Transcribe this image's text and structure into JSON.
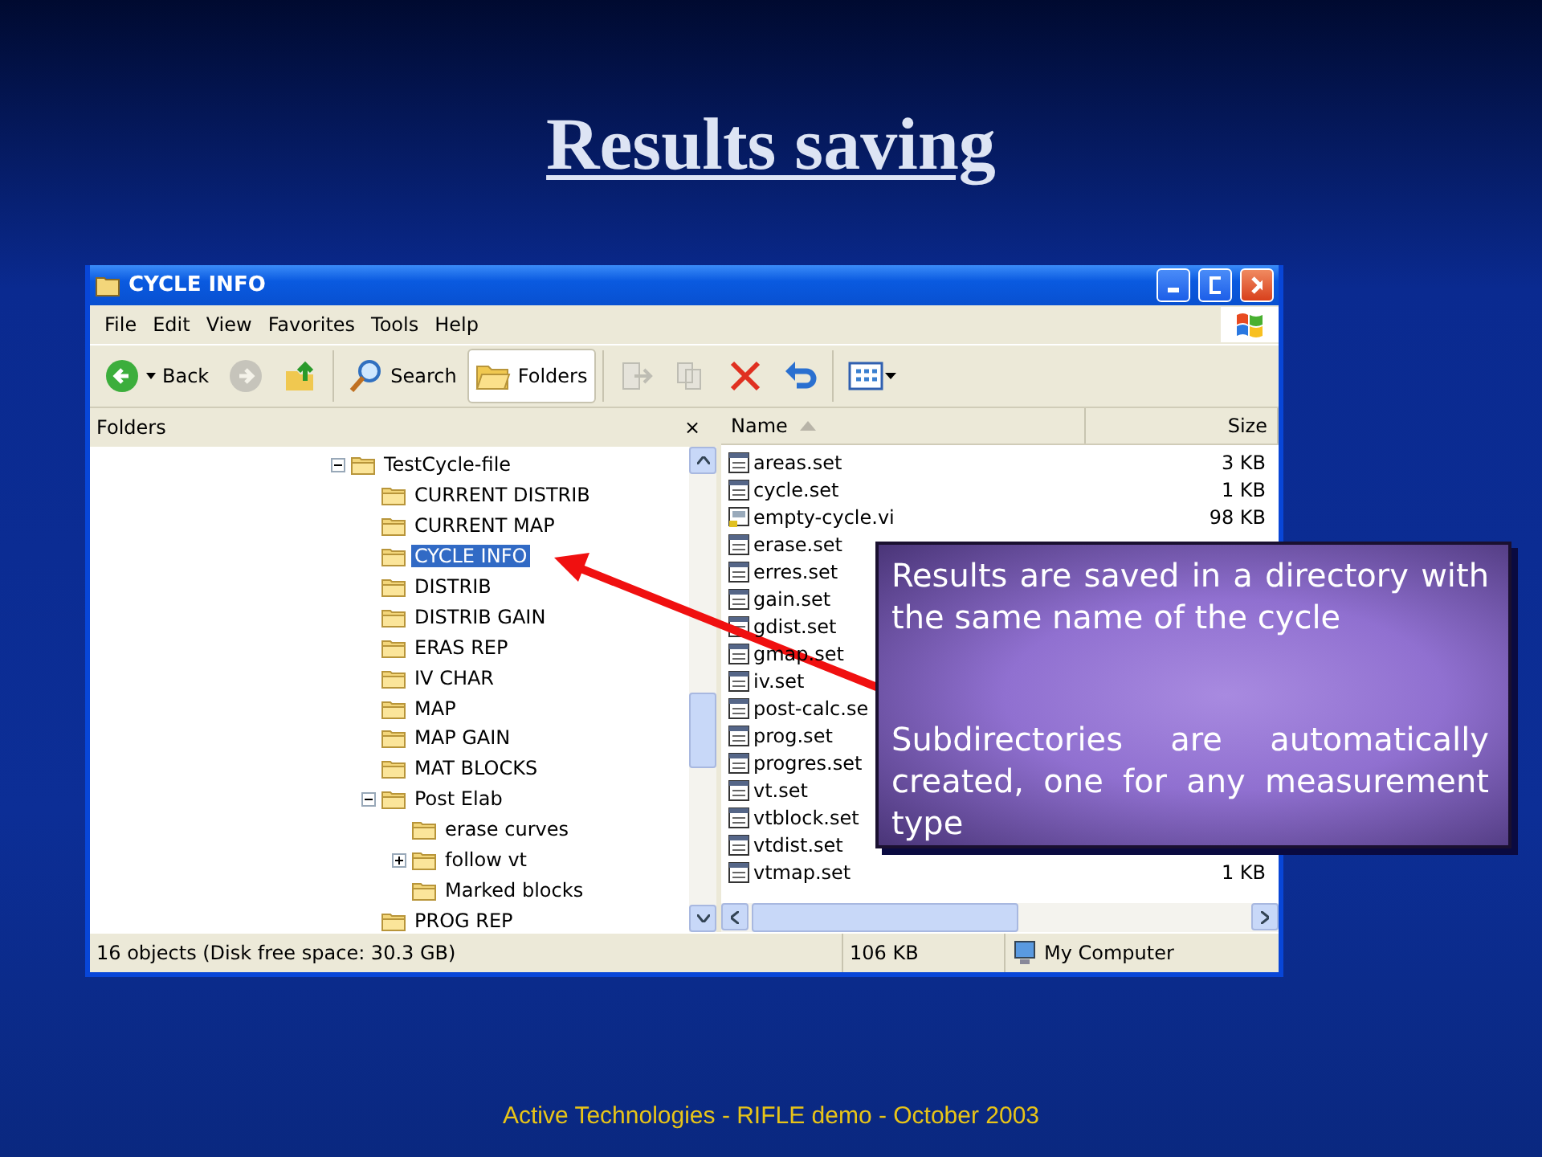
{
  "slide": {
    "title": "Results saving",
    "footer": "Active Technologies - RIFLE demo - October 2003"
  },
  "window": {
    "title": "CYCLE INFO",
    "menu": [
      "File",
      "Edit",
      "View",
      "Favorites",
      "Tools",
      "Help"
    ],
    "toolbar": [
      {
        "kind": "back",
        "label": "Back",
        "selected": false,
        "disabled": false
      },
      {
        "kind": "forward",
        "selected": false,
        "disabled": true
      },
      {
        "kind": "up",
        "selected": false,
        "disabled": false
      },
      {
        "kind": "search",
        "label": "Search",
        "selected": false,
        "disabled": false
      },
      {
        "kind": "folders",
        "label": "Folders",
        "selected": true,
        "disabled": false
      },
      {
        "kind": "move",
        "selected": false,
        "disabled": true
      },
      {
        "kind": "copy",
        "selected": false,
        "disabled": true
      },
      {
        "kind": "delete",
        "selected": false,
        "disabled": false
      },
      {
        "kind": "undo",
        "selected": false,
        "disabled": false
      },
      {
        "kind": "views",
        "selected": false,
        "disabled": false
      }
    ],
    "folders_pane": {
      "title": "Folders",
      "close": "×",
      "tree": [
        {
          "label": "TestCycle-file",
          "expanded": true,
          "selected": false,
          "children": [
            {
              "label": "CURRENT DISTRIB",
              "selected": false
            },
            {
              "label": "CURRENT MAP",
              "selected": false
            },
            {
              "label": "CYCLE INFO",
              "selected": true
            },
            {
              "label": "DISTRIB",
              "selected": false
            },
            {
              "label": "DISTRIB GAIN",
              "selected": false
            },
            {
              "label": "ERAS REP",
              "selected": false
            },
            {
              "label": "IV CHAR",
              "selected": false
            },
            {
              "label": "MAP",
              "selected": false
            },
            {
              "label": "MAP GAIN",
              "selected": false
            },
            {
              "label": "MAT BLOCKS",
              "selected": false
            },
            {
              "label": "Post Elab",
              "expanded": true,
              "selected": false,
              "children": [
                {
                  "label": "erase curves",
                  "selected": false
                },
                {
                  "label": "follow vt",
                  "expanded": false,
                  "selected": false
                },
                {
                  "label": "Marked blocks",
                  "selected": false
                }
              ]
            },
            {
              "label": "PROG REP",
              "selected": false
            }
          ]
        }
      ]
    },
    "file_list": {
      "columns": [
        "Name",
        "Size"
      ],
      "rows": [
        {
          "name": "areas.set",
          "size": "3 KB",
          "kind": "set"
        },
        {
          "name": "cycle.set",
          "size": "1 KB",
          "kind": "set"
        },
        {
          "name": "empty-cycle.vi",
          "size": "98 KB",
          "kind": "vi"
        },
        {
          "name": "erase.set",
          "kind": "set"
        },
        {
          "name": "erres.set",
          "kind": "set"
        },
        {
          "name": "gain.set",
          "kind": "set"
        },
        {
          "name": "gdist.set",
          "kind": "set"
        },
        {
          "name": "gmap.set",
          "kind": "set"
        },
        {
          "name": "iv.set",
          "kind": "set"
        },
        {
          "name": "post-calc.se",
          "kind": "set"
        },
        {
          "name": "prog.set",
          "kind": "set"
        },
        {
          "name": "progres.set",
          "kind": "set"
        },
        {
          "name": "vt.set",
          "kind": "set"
        },
        {
          "name": "vtblock.set",
          "kind": "set"
        },
        {
          "name": "vtdist.set",
          "kind": "set"
        },
        {
          "name": "vtmap.set",
          "size": "1 KB",
          "kind": "set"
        }
      ]
    },
    "status_bar": [
      "16 objects (Disk free space: 30.3 GB)",
      "106 KB",
      "My Computer"
    ]
  },
  "callout": {
    "paragraphs": [
      "Results are saved in a directory with the same name of the cycle",
      "Subdirectories are automatically created, one for any measurement type"
    ]
  }
}
